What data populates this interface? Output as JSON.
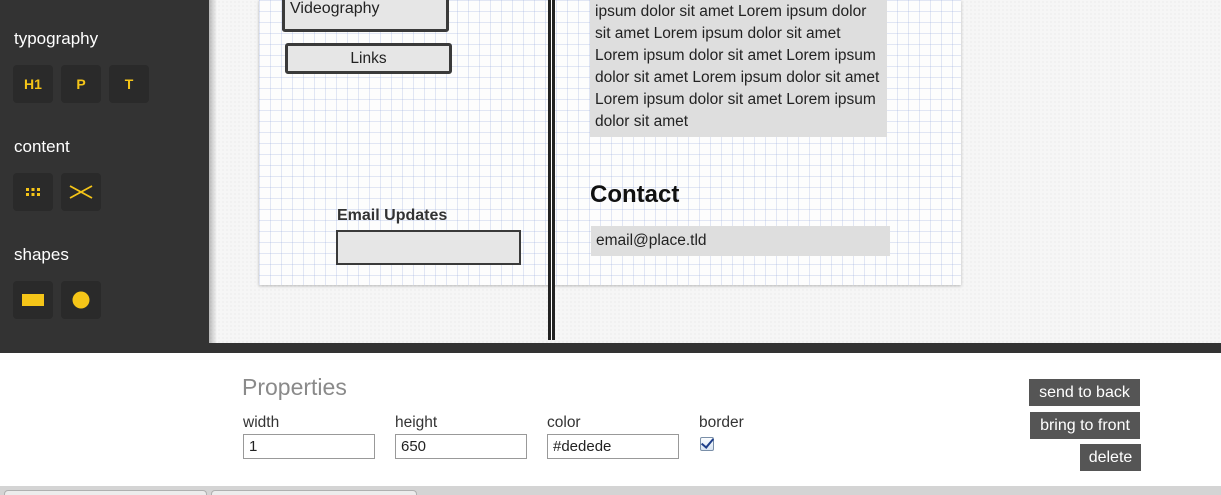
{
  "sidebar": {
    "sections": [
      {
        "heading": "typography",
        "tools": [
          {
            "label": "H1",
            "icon": "h1-tool"
          },
          {
            "label": "P",
            "icon": "paragraph-tool"
          },
          {
            "label": "T",
            "icon": "text-tool"
          }
        ]
      },
      {
        "heading": "content",
        "tools": [
          {
            "icon": "grid-tool"
          },
          {
            "icon": "image-placeholder-tool"
          }
        ]
      },
      {
        "heading": "shapes",
        "tools": [
          {
            "icon": "rectangle-tool"
          },
          {
            "icon": "circle-tool"
          }
        ]
      }
    ],
    "accent_color": "#f5c518"
  },
  "canvas": {
    "nav_buttons": {
      "videography": "Videography",
      "links": "Links"
    },
    "lorem_text": "ipsum dolor sit amet Lorem ipsum dolor sit amet Lorem ipsum dolor sit amet Lorem ipsum dolor sit amet Lorem ipsum dolor sit amet Lorem ipsum dolor sit amet Lorem ipsum dolor sit amet Lorem ipsum dolor sit amet",
    "contact_title": "Contact",
    "email_text": "email@place.tld",
    "email_updates_label": "Email Updates"
  },
  "properties": {
    "title": "Properties",
    "width": {
      "label": "width",
      "value": "1"
    },
    "height": {
      "label": "height",
      "value": "650"
    },
    "color": {
      "label": "color",
      "value": "#dedede"
    },
    "border": {
      "label": "border",
      "checked": true
    },
    "actions": {
      "send_to_back": "send to back",
      "bring_to_front": "bring to front",
      "delete": "delete"
    }
  }
}
